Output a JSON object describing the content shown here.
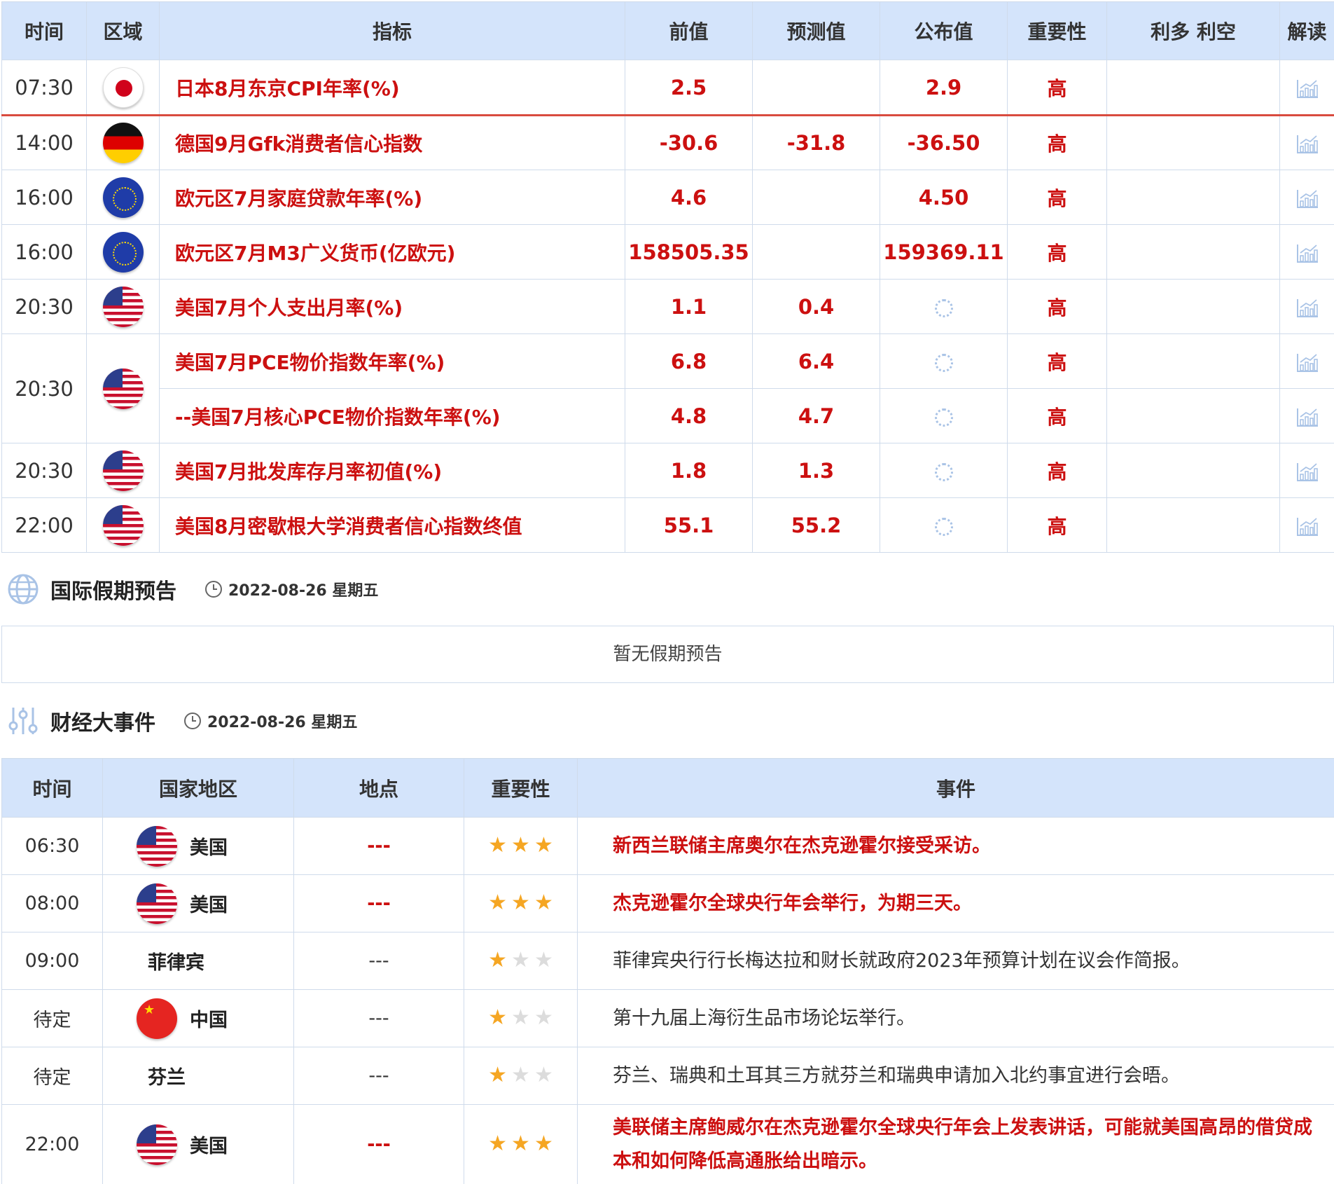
{
  "indicators": {
    "headers": [
      "时间",
      "区域",
      "指标",
      "前值",
      "预测值",
      "公布值",
      "重要性",
      "利多 利空",
      "解读"
    ],
    "rows": [
      {
        "time": "07:30",
        "flag": "jp-flag-icon",
        "indicator": "日本8月东京CPI年率(%)",
        "prev": "2.5",
        "forecast": "",
        "actual": "2.9",
        "importance": "高"
      },
      {
        "time": "14:00",
        "flag": "de-flag-icon",
        "indicator": "德国9月Gfk消费者信心指数",
        "prev": "-30.6",
        "forecast": "-31.8",
        "actual": "-36.50",
        "importance": "高"
      },
      {
        "time": "16:00",
        "flag": "eu-flag-icon",
        "indicator": "欧元区7月家庭贷款年率(%)",
        "prev": "4.6",
        "forecast": "",
        "actual": "4.50",
        "importance": "高"
      },
      {
        "time": "16:00",
        "flag": "eu-flag-icon",
        "indicator": "欧元区7月M3广义货币(亿欧元)",
        "prev": "158505.35",
        "forecast": "",
        "actual": "159369.11",
        "importance": "高"
      },
      {
        "time": "20:30",
        "flag": "us-flag-icon",
        "indicator": "美国7月个人支出月率(%)",
        "prev": "1.1",
        "forecast": "0.4",
        "actual": "",
        "importance": "高"
      },
      {
        "time": "20:30",
        "flag": "us-flag-icon",
        "indicator": "美国7月PCE物价指数年率(%)",
        "prev": "6.8",
        "forecast": "6.4",
        "actual": "",
        "importance": "高"
      },
      {
        "time": "",
        "flag": "",
        "indicator": "--美国7月核心PCE物价指数年率(%)",
        "prev": "4.8",
        "forecast": "4.7",
        "actual": "",
        "importance": "高"
      },
      {
        "time": "20:30",
        "flag": "us-flag-icon",
        "indicator": "美国7月批发库存月率初值(%)",
        "prev": "1.8",
        "forecast": "1.3",
        "actual": "",
        "importance": "高"
      },
      {
        "time": "22:00",
        "flag": "us-flag-icon",
        "indicator": "美国8月密歇根大学消费者信心指数终值",
        "prev": "55.1",
        "forecast": "55.2",
        "actual": "",
        "importance": "高"
      }
    ]
  },
  "holidays": {
    "title": "国际假期预告",
    "date": "2022-08-26 星期五",
    "empty_text": "暂无假期预告"
  },
  "events": {
    "title": "财经大事件",
    "date": "2022-08-26 星期五",
    "headers": [
      "时间",
      "国家地区",
      "地点",
      "重要性",
      "事件"
    ],
    "rows": [
      {
        "time": "06:30",
        "country": "美国",
        "flag": "us-flag-icon",
        "place": "---",
        "stars": 3,
        "event": "新西兰联储主席奥尔在杰克逊霍尔接受采访。"
      },
      {
        "time": "08:00",
        "country": "美国",
        "flag": "us-flag-icon",
        "place": "---",
        "stars": 3,
        "event": "杰克逊霍尔全球央行年会举行，为期三天。"
      },
      {
        "time": "09:00",
        "country": "菲律宾",
        "flag": "",
        "place": "---",
        "stars": 1,
        "event": "菲律宾央行行长梅达拉和财长就政府2023年预算计划在议会作简报。"
      },
      {
        "time": "待定",
        "country": "中国",
        "flag": "cn-flag-icon",
        "place": "---",
        "stars": 1,
        "event": "第十九届上海衍生品市场论坛举行。"
      },
      {
        "time": "待定",
        "country": "芬兰",
        "flag": "",
        "place": "---",
        "stars": 1,
        "event": "芬兰、瑞典和土耳其三方就芬兰和瑞典申请加入北约事宜进行会晤。"
      },
      {
        "time": "22:00",
        "country": "美国",
        "flag": "us-flag-icon",
        "place": "---",
        "stars": 3,
        "event": "美联储主席鲍威尔在杰克逊霍尔全球央行年会上发表讲话，可能就美国高昂的借贷成本和如何降低高通胀给出暗示。"
      }
    ]
  }
}
